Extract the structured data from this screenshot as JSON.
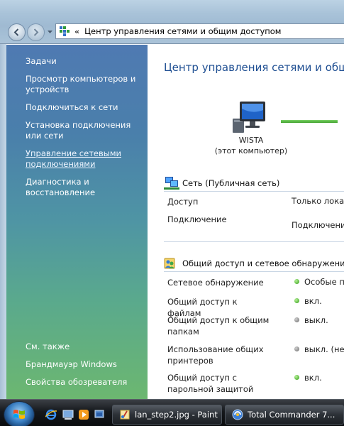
{
  "address_bar": {
    "chevron": "«",
    "path": "Центр управления сетями и общим доступом"
  },
  "taskpane": {
    "tasks_header": "Задачи",
    "links": [
      "Просмотр компьютеров и устройств",
      "Подключиться к сети",
      "Установка подключения или сети",
      "Управление сетевыми подключениями",
      "Диагностика и восстановление"
    ],
    "see_also_header": "См. также",
    "see_also_links": [
      "Брандмауэр Windows",
      "Свойства обозревателя"
    ]
  },
  "main": {
    "title": "Центр управления сетями и общим доступом",
    "computer_name": "WISTA",
    "computer_sub": "(этот компьютер)",
    "network_section": {
      "title": "Сеть (Публичная сеть)",
      "rows": [
        {
          "label": "Доступ",
          "value": "Только локальная сеть"
        },
        {
          "label": "Подключение",
          "value": "Подключение по локальной сети"
        }
      ]
    },
    "sharing_section": {
      "title": "Общий доступ и сетевое обнаружение",
      "rows": [
        {
          "label": "Сетевое обнаружение",
          "value": "Особые параметры",
          "status": "green"
        },
        {
          "label": "Общий доступ к файлам",
          "value": "вкл.",
          "status": "green"
        },
        {
          "label": "Общий доступ к общим папкам",
          "value": "выкл.",
          "status": "gray"
        },
        {
          "label": "Использование общих принтеров",
          "value": "выкл. (нет принтеров)",
          "status": "gray"
        },
        {
          "label": "Общий доступ с парольной защитой",
          "value": "вкл.",
          "status": "green"
        }
      ]
    }
  },
  "taskbar": {
    "quicklaunch": [
      "ie-icon",
      "show-desktop-icon",
      "media-player-icon",
      "switch-windows-icon"
    ],
    "tasks": [
      {
        "label": "lan_step2.jpg - Paint"
      },
      {
        "label": "Total Commander 7..."
      }
    ]
  },
  "colors": {
    "title_blue": "#1e4e92",
    "status_on": "#2e9a12",
    "status_off": "#6b6b6b"
  }
}
